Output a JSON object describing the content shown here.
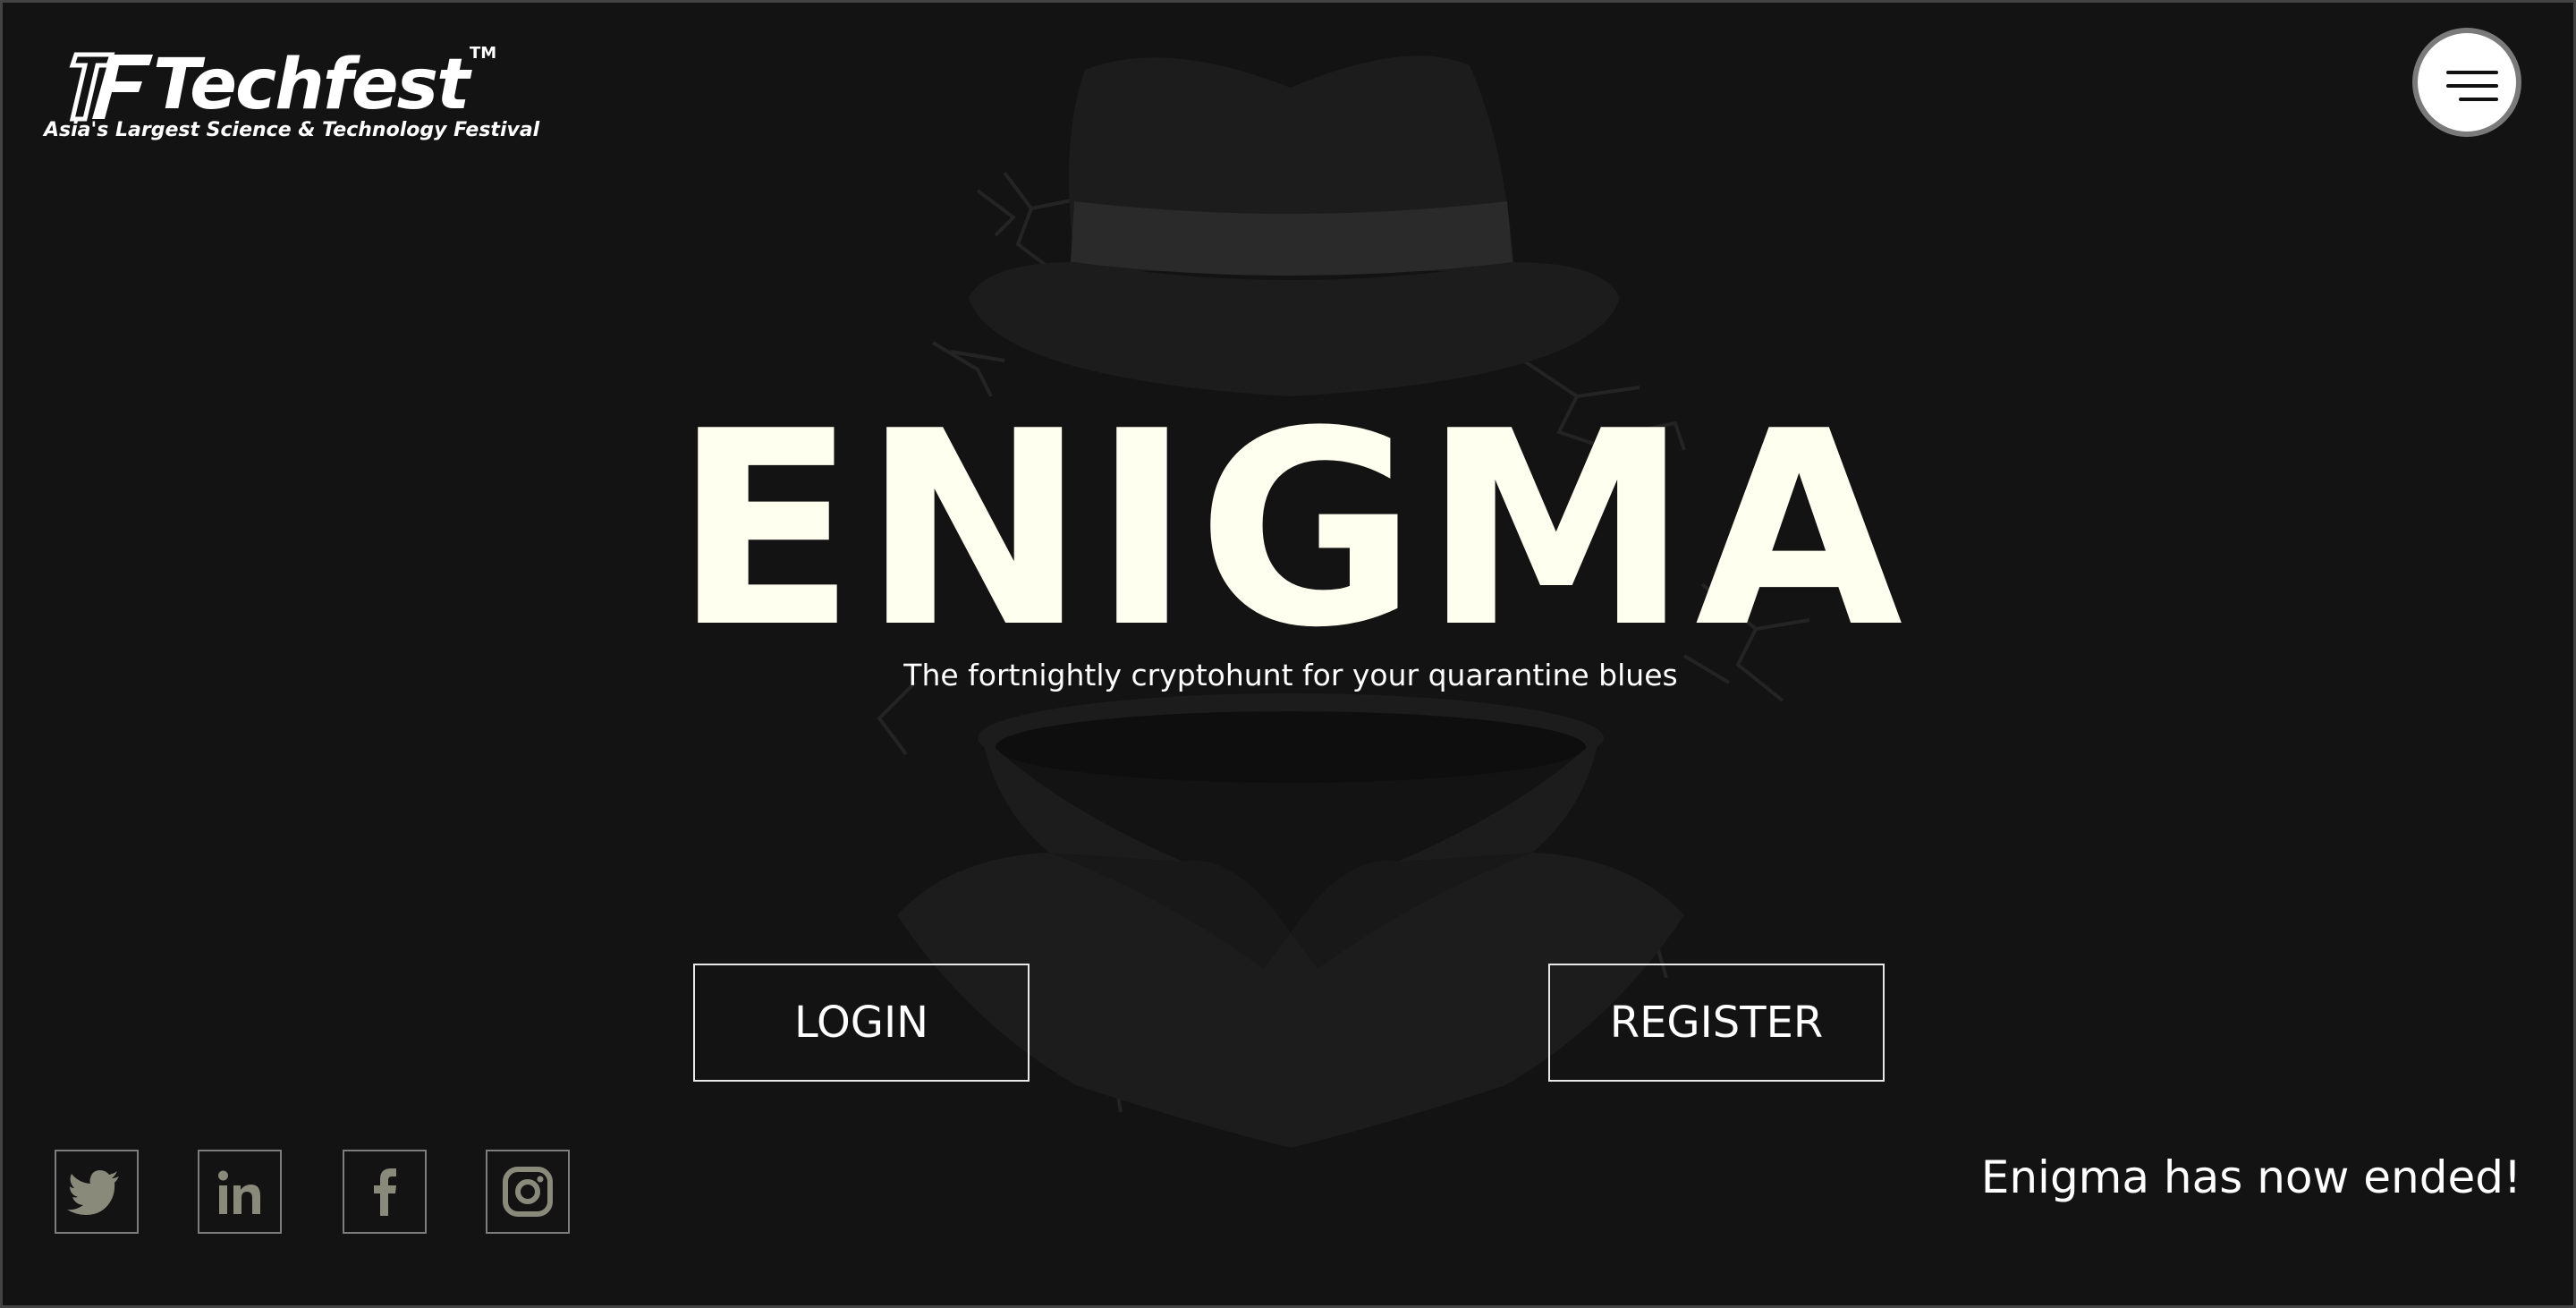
{
  "brand": {
    "name": "Techfest",
    "trademark": "TM",
    "tagline": "Asia's Largest Science & Technology Festival"
  },
  "menu": {
    "icon": "hamburger-menu-icon"
  },
  "hero": {
    "title": "ENIGMA",
    "subtitle": "The fortnightly cryptohunt for your quarantine blues"
  },
  "actions": {
    "login_label": "LOGIN",
    "register_label": "REGISTER"
  },
  "social": [
    {
      "name": "twitter",
      "icon": "twitter-icon"
    },
    {
      "name": "linkedin",
      "icon": "linkedin-icon"
    },
    {
      "name": "facebook",
      "icon": "facebook-icon"
    },
    {
      "name": "instagram",
      "icon": "instagram-icon"
    }
  ],
  "status": {
    "message": "Enigma has now ended!"
  },
  "colors": {
    "background": "#131313",
    "title": "#fffff0",
    "figure": "#1d1d1d",
    "social_icon": "#8a8a7a"
  }
}
